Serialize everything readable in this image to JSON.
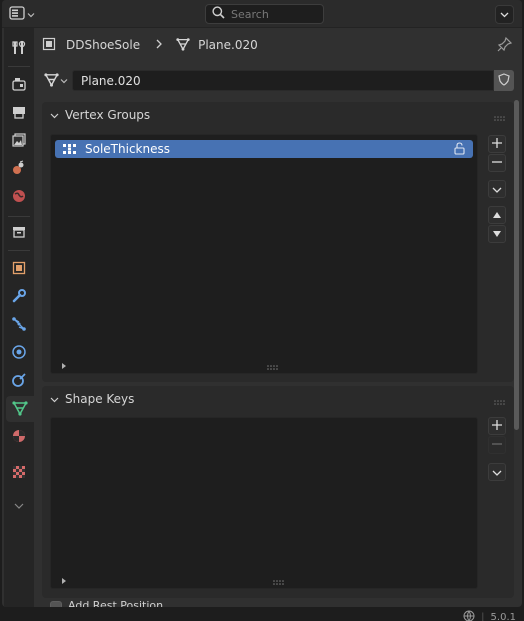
{
  "header": {
    "search_placeholder": "Search",
    "editor_icon": "properties-editor-icon",
    "options_icon": "chevron-down-icon"
  },
  "breadcrumb": {
    "object_name": "DDShoeSole",
    "mesh_name": "Plane.020"
  },
  "datablock": {
    "name": "Plane.020",
    "fake_user_icon": "shield-icon"
  },
  "tabs": [
    {
      "name": "tool-tab",
      "icon": "wrench-screwdriver-icon"
    },
    {
      "name": "render-tab",
      "icon": "camera-back-icon"
    },
    {
      "name": "output-tab",
      "icon": "printer-icon"
    },
    {
      "name": "view-layer-tab",
      "icon": "image-stack-icon"
    },
    {
      "name": "scene-tab",
      "icon": "scene-icon"
    },
    {
      "name": "world-tab",
      "icon": "world-icon"
    },
    {
      "name": "collection-tab",
      "icon": "collection-box-icon"
    },
    {
      "name": "object-tab",
      "icon": "object-square-icon"
    },
    {
      "name": "modifiers-tab",
      "icon": "wrench-icon"
    },
    {
      "name": "particles-tab",
      "icon": "particles-icon"
    },
    {
      "name": "physics-tab",
      "icon": "physics-icon"
    },
    {
      "name": "constraints-tab",
      "icon": "constraint-icon"
    },
    {
      "name": "data-tab",
      "icon": "mesh-data-icon",
      "active": true
    },
    {
      "name": "material-tab",
      "icon": "material-sphere-icon"
    },
    {
      "name": "texture-tab",
      "icon": "checker-texture-icon"
    }
  ],
  "panels": {
    "vertex_groups": {
      "title": "Vertex Groups",
      "items": [
        {
          "name": "SoleThickness",
          "selected": true,
          "locked": false
        }
      ]
    },
    "shape_keys": {
      "title": "Shape Keys",
      "items": []
    },
    "add_rest_position_label": "Add Rest Position"
  },
  "status": {
    "version": "5.0.1"
  },
  "colors": {
    "accent": "#4772b3",
    "data_icon": "#52c78a",
    "panel_bg": "#2a2a2a",
    "list_bg": "#1e1e1e"
  }
}
